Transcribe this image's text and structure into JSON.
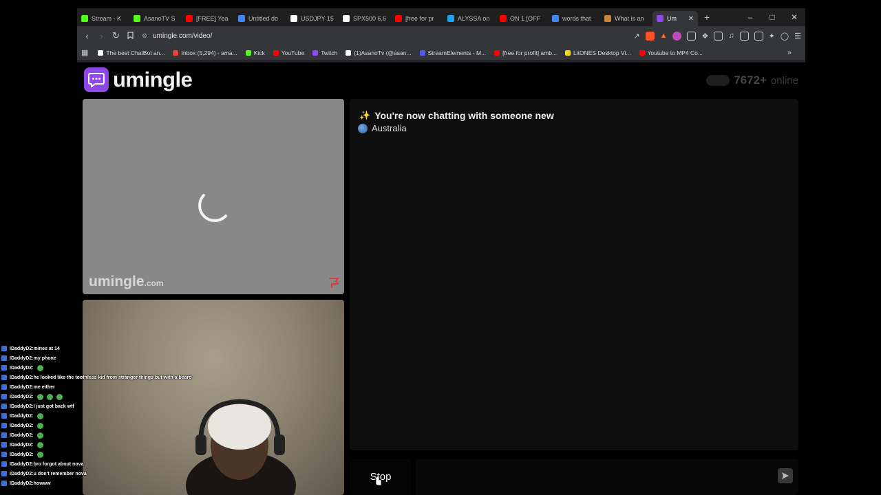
{
  "browser": {
    "tabs": [
      {
        "title": "Stream - K",
        "color": "#53fc18"
      },
      {
        "title": "AsanoTV S",
        "color": "#53fc18"
      },
      {
        "title": "[FREE] Yea",
        "color": "#ff0000"
      },
      {
        "title": "Untitled do",
        "color": "#4285f4"
      },
      {
        "title": "USDJPY 15",
        "color": "#ffffff"
      },
      {
        "title": "SPX500 6,6",
        "color": "#ffffff"
      },
      {
        "title": "[free for pr",
        "color": "#ff0000"
      },
      {
        "title": "ALYSSA on",
        "color": "#1da1f2"
      },
      {
        "title": "ON 1 [OFF",
        "color": "#ff0000"
      },
      {
        "title": "words that",
        "color": "#4285f4"
      },
      {
        "title": "What is an",
        "color": "#c8843a"
      },
      {
        "title": "Um",
        "color": "#8f47e8",
        "active": true
      }
    ],
    "new_tab": "+",
    "window_controls": {
      "minimize": "–",
      "maximize": "□",
      "close": "✕"
    },
    "url": "umingle.com/video/",
    "bookmarks": [
      {
        "label": "The best ChatBot an...",
        "color": "#ffffff"
      },
      {
        "label": "Inbox (5,294) - ama...",
        "color": "#ea4335"
      },
      {
        "label": "Kick",
        "color": "#53fc18"
      },
      {
        "label": "YouTube",
        "color": "#ff0000"
      },
      {
        "label": "Twitch",
        "color": "#9146ff"
      },
      {
        "label": "(1)AsanoTv (@asan...",
        "color": "#ffffff"
      },
      {
        "label": "StreamElements - M...",
        "color": "#4b5cf0"
      },
      {
        "label": "[free for profit] amb...",
        "color": "#ff0000"
      },
      {
        "label": "LitONES Desktop Vi...",
        "color": "#f5d90a"
      },
      {
        "label": "Youtube to MP4 Co...",
        "color": "#ff0000"
      }
    ],
    "bookmarks_more": "»"
  },
  "page": {
    "logo_text": "umingle",
    "online_count": "7672+",
    "online_label": "online",
    "watermark": "umingle",
    "watermark_suffix": ".com",
    "chat_status": "You're now chatting with someone new",
    "country": "Australia",
    "stop_label": "Stop",
    "message_placeholder": "",
    "accent": "#8f47e8"
  },
  "overlay_chat": [
    {
      "user": "IDaddyD2",
      "text": "mines at 14",
      "emotes": 0
    },
    {
      "user": "IDaddyD2",
      "text": "my phone",
      "emotes": 0
    },
    {
      "user": "IDaddyD2",
      "text": "",
      "emotes": 1
    },
    {
      "user": "IDaddyD2",
      "text": "he looked like the toothless kid from stranger things but with a beard",
      "emotes": 0
    },
    {
      "user": "IDaddyD2",
      "text": "me either",
      "emotes": 0
    },
    {
      "user": "IDaddyD2",
      "text": "",
      "emotes": 3
    },
    {
      "user": "IDaddyD2",
      "text": "I just got back wtf",
      "emotes": 0
    },
    {
      "user": "IDaddyD2",
      "text": "",
      "emotes": 1
    },
    {
      "user": "IDaddyD2",
      "text": "",
      "emotes": 1
    },
    {
      "user": "IDaddyD2",
      "text": "",
      "emotes": 1
    },
    {
      "user": "IDaddyD2",
      "text": "",
      "emotes": 1
    },
    {
      "user": "IDaddyD2",
      "text": "",
      "emotes": 1
    },
    {
      "user": "IDaddyD2",
      "text": "bro forgot about nova",
      "emotes": 0
    },
    {
      "user": "IDaddyD2",
      "text": "u don't remember nova",
      "emotes": 0
    },
    {
      "user": "IDaddyD2",
      "text": "howww",
      "emotes": 0
    }
  ]
}
